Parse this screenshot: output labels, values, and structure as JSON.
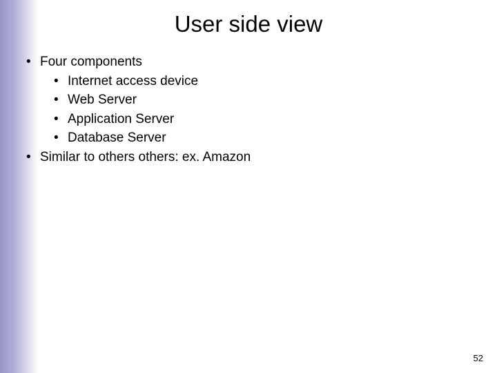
{
  "title": "User side view",
  "bullets_l1_0": "Four components",
  "bullets_l2": {
    "0": "Internet access device",
    "1": "Web Server",
    "2": "Application Server",
    "3": "Database Server"
  },
  "bullets_l1_1": "Similar to others others:  ex. Amazon",
  "page_number": "52"
}
